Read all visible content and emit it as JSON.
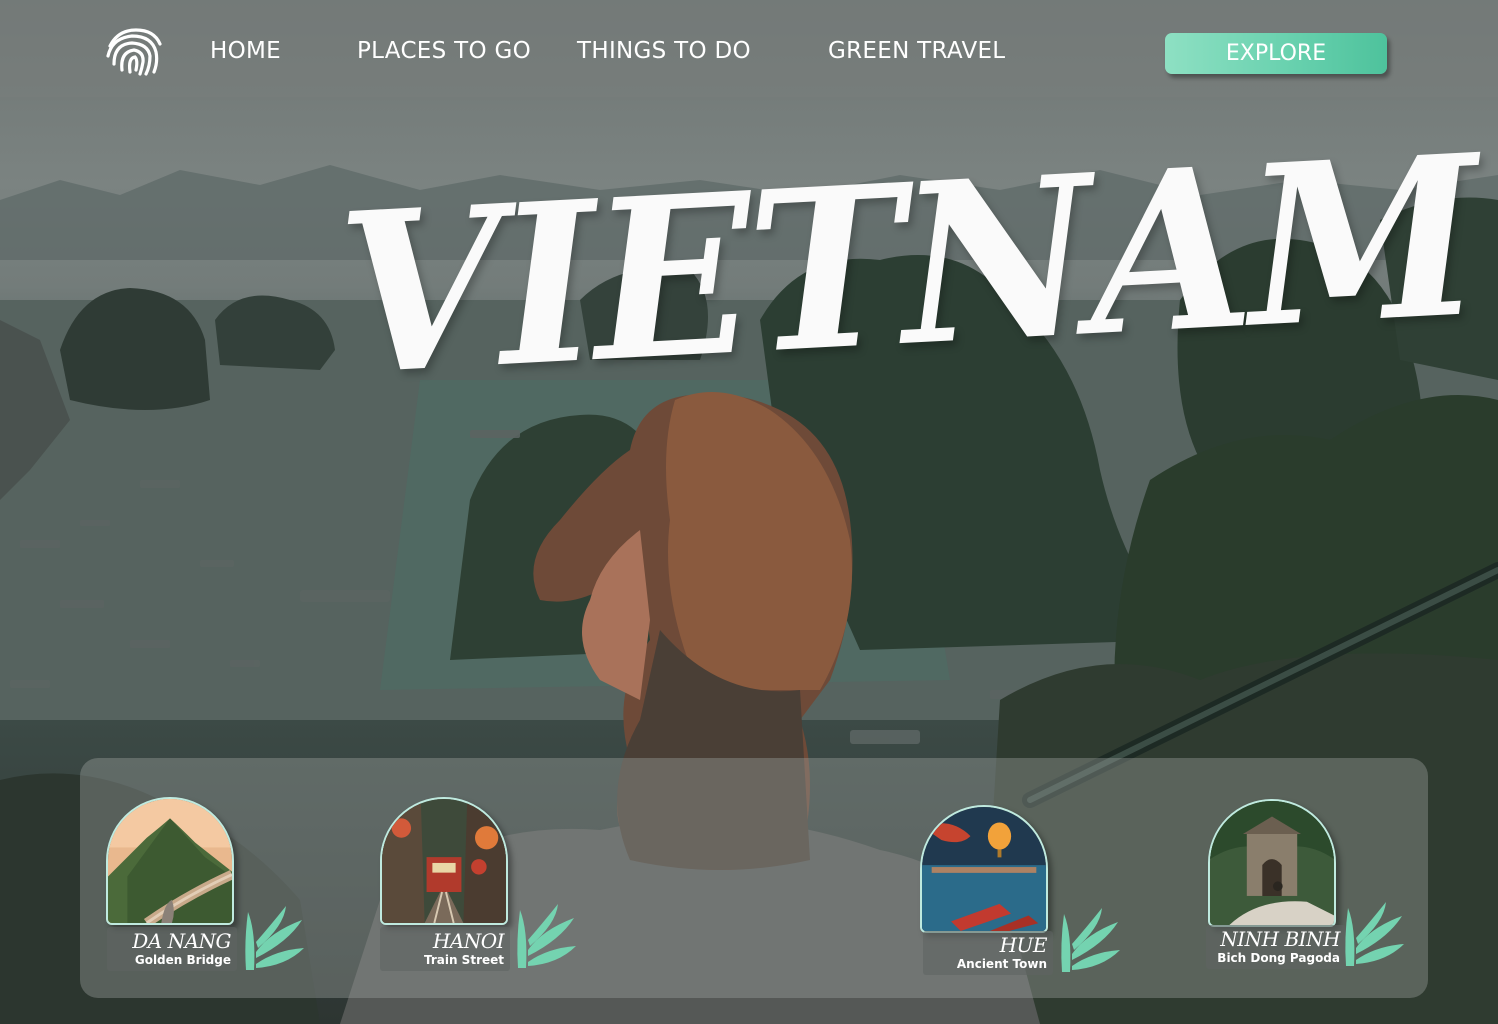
{
  "nav": {
    "links": [
      {
        "label": "HOME"
      },
      {
        "label": "PLACES TO GO"
      },
      {
        "label": "THINGS TO DO"
      },
      {
        "label": "GREEN TRAVEL"
      }
    ],
    "cta_label": "EXPLORE",
    "logo_icon": "fingerprint-icon"
  },
  "hero": {
    "title": "VIETNAM"
  },
  "destinations": [
    {
      "name": "DA NANG",
      "subtitle": "Golden Bridge",
      "icon": "bamboo-leaf-icon"
    },
    {
      "name": "HANOI",
      "subtitle": "Train Street",
      "icon": "bamboo-leaf-icon"
    },
    {
      "name": "HUE",
      "subtitle": "Ancient Town",
      "icon": "bamboo-leaf-icon"
    },
    {
      "name": "NINH BINH",
      "subtitle": "Bich Dong Pagoda",
      "icon": "bamboo-leaf-icon"
    }
  ],
  "colors": {
    "accent": "#66d0ad",
    "accent_light": "#8ee0c3",
    "text": "#ffffff"
  }
}
